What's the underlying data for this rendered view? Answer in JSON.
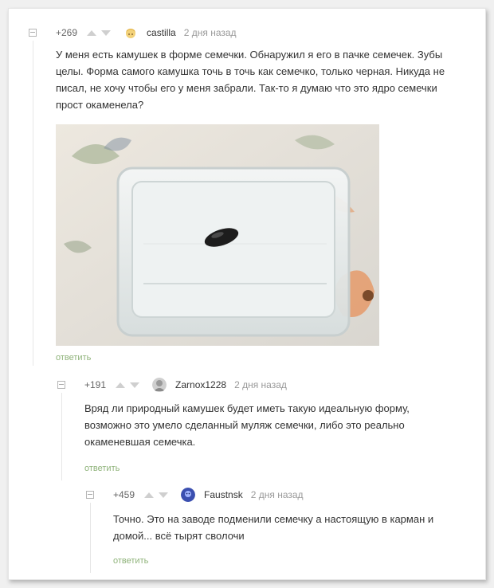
{
  "comments": [
    {
      "rating": "+269",
      "username": "castilla",
      "time": "2 дня назад",
      "text": "У меня есть камушек в форме семечки. Обнаружил я его в пачке семечек. Зубы целы. Форма самого камушка точь в точь как семечко, только черная. Никуда не писал, не хочу чтобы его у меня забрали. Так-то я думаю что это ядро семечки прост окаменела?",
      "reply": "ответить",
      "avatar_icon": "blonde-user-avatar-icon"
    },
    {
      "rating": "+191",
      "username": "Zarnox1228",
      "time": "2 дня назад",
      "text": "Вряд ли природный камушек будет иметь такую идеальную форму, возможно это умело сделанный муляж семечки, либо это реально окаменевшая семечка.",
      "reply": "ответить",
      "avatar_icon": "gray-user-avatar-icon"
    },
    {
      "rating": "+459",
      "username": "Faustnsk",
      "time": "2 дня назад",
      "text": "Точно. Это на заводе подменили семечку а настоящую в карман и домой... всё тырят сволочи",
      "reply": "ответить",
      "avatar_icon": "blue-user-avatar-icon"
    }
  ],
  "colors": {
    "reply_link": "#8fb37a",
    "username": "#333333",
    "meta": "#999999"
  }
}
